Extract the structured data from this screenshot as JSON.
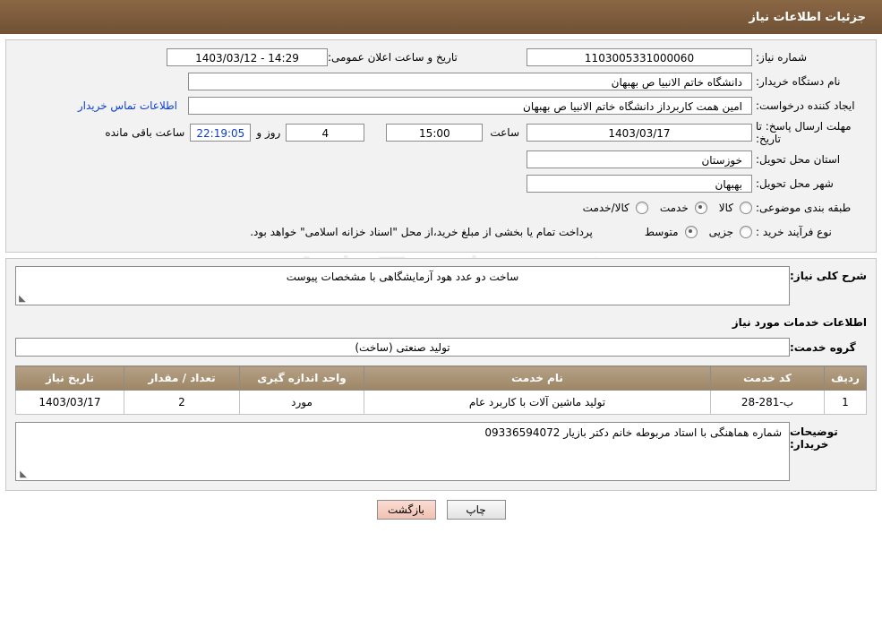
{
  "header": {
    "title": "جزئیات اطلاعات نیاز"
  },
  "watermark": {
    "text": "AriaTender.net"
  },
  "top": {
    "need_number_label": "شماره نیاز:",
    "need_number_value": "1103005331000060",
    "announce_datetime_label": "تاریخ و ساعت اعلان عمومی:",
    "announce_datetime_value": "14:29 - 1403/03/12",
    "buyer_org_label": "نام دستگاه خریدار:",
    "buyer_org_value": "دانشگاه خاتم الانبیا  ص  بهبهان",
    "requester_label": "ایجاد کننده درخواست:",
    "requester_value": "امین همت کاربرداز دانشگاه خاتم الانبیا  ص  بهبهان",
    "contact_link": "اطلاعات تماس خریدار",
    "deadline_label": "مهلت ارسال پاسخ: تا تاریخ:",
    "deadline_date": "1403/03/17",
    "hour_label": "ساعت",
    "deadline_time": "15:00",
    "days_value": "4",
    "days_label": "روز و",
    "countdown_value": "22:19:05",
    "remaining_label": "ساعت باقی مانده",
    "province_label": "استان محل تحویل:",
    "province_value": "خوزستان",
    "city_label": "شهر محل تحویل:",
    "city_value": "بهبهان",
    "category_label": "طبقه بندی موضوعی:",
    "category_options": [
      {
        "label": "کالا",
        "checked": false
      },
      {
        "label": "خدمت",
        "checked": false
      },
      {
        "label": "کالا/خدمت",
        "checked": true
      }
    ],
    "purchase_type_label": "نوع فرآیند خرید :",
    "purchase_type_options": [
      {
        "label": "جزیی",
        "checked": false
      },
      {
        "label": "متوسط",
        "checked": true
      }
    ],
    "purchase_note": "پرداخت تمام یا بخشی از مبلغ خرید،از محل \"اسناد خزانه اسلامی\" خواهد بود."
  },
  "mid": {
    "general_need_label": "شرح کلی نیاز:",
    "general_need_value": "ساخت دو عدد هود آزمایشگاهی با مشخصات پیوست",
    "services_section_title": "اطلاعات خدمات مورد نیاز",
    "service_group_label": "گروه خدمت:",
    "service_group_value": "تولید صنعتی (ساخت)",
    "table": {
      "columns": [
        "ردیف",
        "کد خدمت",
        "نام خدمت",
        "واحد اندازه گیری",
        "تعداد / مقدار",
        "تاریخ نیاز"
      ],
      "rows": [
        [
          "1",
          "ب-281-28",
          "تولید ماشین آلات با کاربرد عام",
          "مورد",
          "2",
          "1403/03/17"
        ]
      ]
    },
    "buyer_notes_label": "توضیحات خریدار:",
    "buyer_notes_value": "شماره هماهنگی با استاد مربوطه خانم دکتر بازیار 09336594072"
  },
  "footer": {
    "print_label": "چاپ",
    "back_label": "بازگشت"
  },
  "colors": {
    "header_bg": "#7b5a3e",
    "table_header_bg": "#a99478",
    "link": "#0b3fd0",
    "back_button": "#f6cfc4"
  }
}
